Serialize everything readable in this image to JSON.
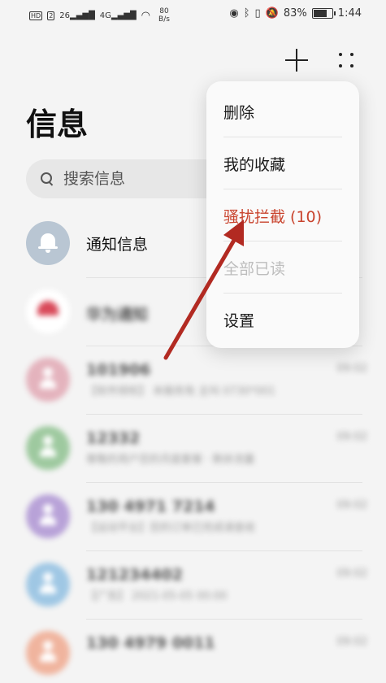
{
  "status_bar": {
    "left_chip": "HD",
    "left_chip2": "2",
    "sim1": "26",
    "sim2": "4G",
    "speed_value": "80",
    "speed_unit": "B/s",
    "battery": "83%",
    "battery_level": 0.83,
    "time": "1:44"
  },
  "header": {
    "title": "信息"
  },
  "search": {
    "placeholder": "搜索信息"
  },
  "conversations": [
    {
      "title": "通知信息",
      "avatar_color": "#b9c6d3",
      "icon": "bell-icon"
    },
    {
      "title": "华为通知",
      "avatar_color": "#d94a5a"
    },
    {
      "title": "101906",
      "time": "09:02",
      "preview": "【软件授权】 本服务免 主叫 0730*001",
      "avatar_color": "#e4b3bd"
    },
    {
      "title": "12332",
      "time": "09:02",
      "preview": "尊敬的用户您的月度套餐 · 剩余流量",
      "avatar_color": "#9ec99f"
    },
    {
      "title": "130 4971 7214",
      "time": "09:02",
      "preview": "【运动平台】您的订单已完成请查收",
      "avatar_color": "#b8a2d8"
    },
    {
      "title": "121234402",
      "time": "09:02",
      "preview": "【广告】 2021-05-05 00:00",
      "avatar_color": "#9fc7e4"
    },
    {
      "title": "130 4979 0011",
      "time": "09:02",
      "preview": "",
      "avatar_color": "#f0b49e"
    }
  ],
  "menu": {
    "items": [
      {
        "label": "删除",
        "state": "normal"
      },
      {
        "label": "我的收藏",
        "state": "normal"
      },
      {
        "label": "骚扰拦截 (10)",
        "state": "highlight"
      },
      {
        "label": "全部已读",
        "state": "disabled"
      },
      {
        "label": "设置",
        "state": "normal"
      }
    ]
  },
  "colors": {
    "accent_red": "#c9442e",
    "annotation_arrow": "#b22a22"
  }
}
